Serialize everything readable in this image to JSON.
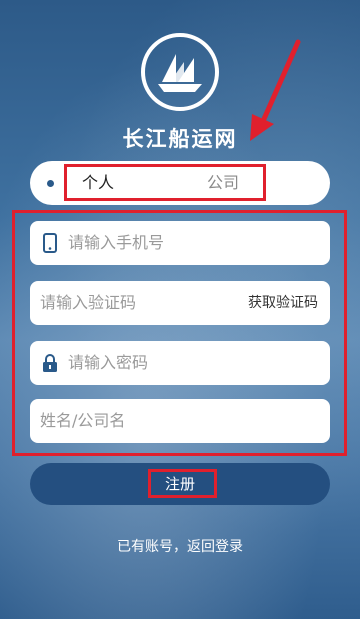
{
  "brand": {
    "name": "长江船运网"
  },
  "tabs": [
    {
      "label": "个人",
      "selected": true
    },
    {
      "label": "公司",
      "selected": false
    }
  ],
  "form": {
    "phone_placeholder": "请输入手机号",
    "code_placeholder": "请输入验证码",
    "get_code_label": "获取验证码",
    "password_placeholder": "请输入密码",
    "name_placeholder": "姓名/公司名"
  },
  "register": {
    "label": "注册"
  },
  "login_link": "已有账号，返回登录",
  "icons": [
    "logo-ship-icon",
    "phone-icon",
    "lock-icon",
    "arrow-annotation-icon"
  ],
  "colors": {
    "accent": "#244f80",
    "highlight": "#e0202d"
  }
}
